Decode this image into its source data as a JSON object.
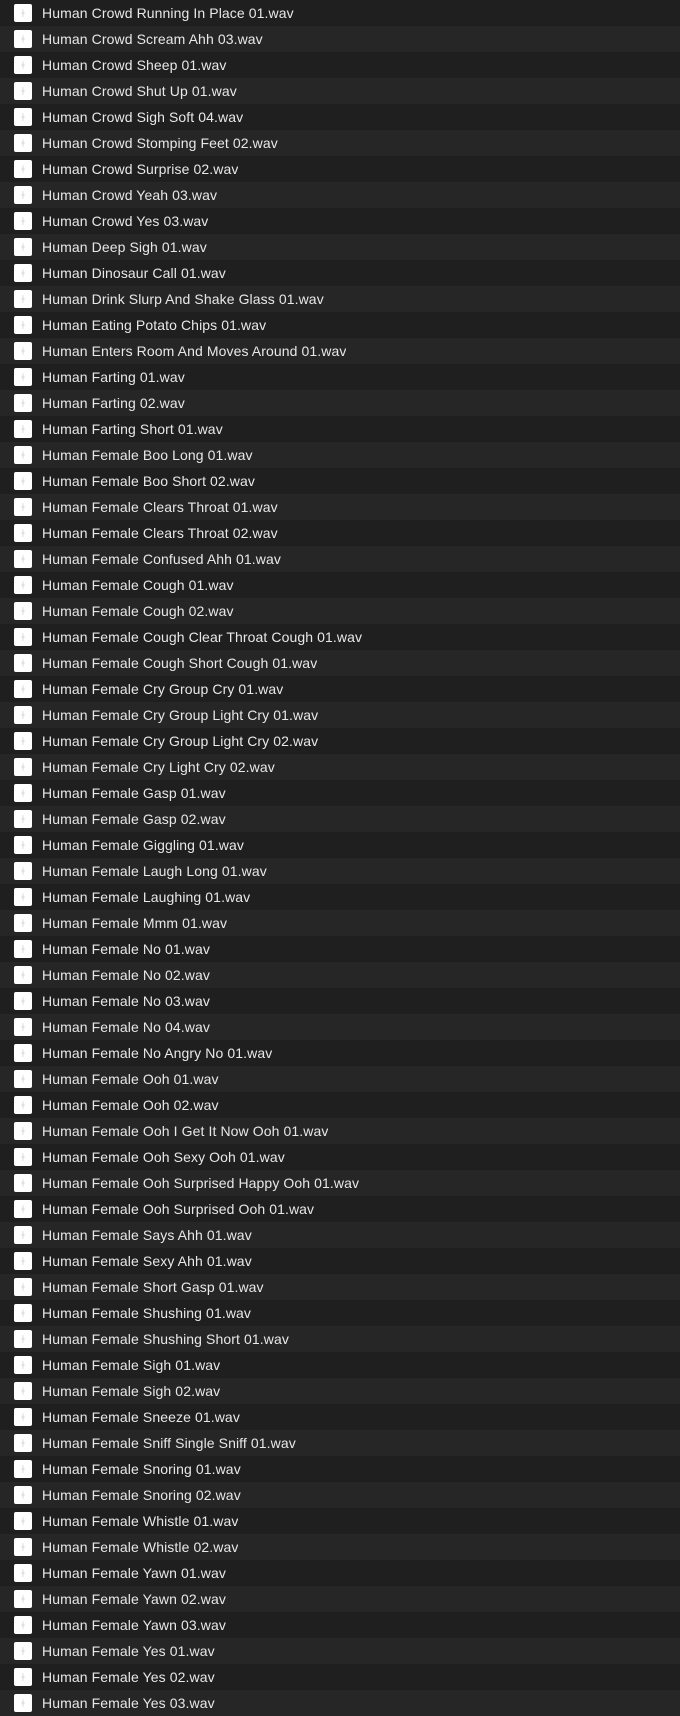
{
  "files": [
    "Human Crowd Running In Place 01.wav",
    "Human Crowd Scream Ahh 03.wav",
    "Human Crowd Sheep 01.wav",
    "Human Crowd Shut Up 01.wav",
    "Human Crowd Sigh Soft 04.wav",
    "Human Crowd Stomping Feet 02.wav",
    "Human Crowd Surprise 02.wav",
    "Human Crowd Yeah 03.wav",
    "Human Crowd Yes 03.wav",
    "Human Deep Sigh 01.wav",
    "Human Dinosaur Call 01.wav",
    "Human Drink Slurp And Shake Glass 01.wav",
    "Human Eating Potato Chips 01.wav",
    "Human Enters Room And Moves Around 01.wav",
    "Human Farting 01.wav",
    "Human Farting 02.wav",
    "Human Farting Short 01.wav",
    "Human Female Boo Long 01.wav",
    "Human Female Boo Short 02.wav",
    "Human Female Clears Throat 01.wav",
    "Human Female Clears Throat 02.wav",
    "Human Female Confused Ahh 01.wav",
    "Human Female Cough 01.wav",
    "Human Female Cough 02.wav",
    "Human Female Cough Clear Throat Cough 01.wav",
    "Human Female Cough Short Cough 01.wav",
    "Human Female Cry Group Cry 01.wav",
    "Human Female Cry Group Light Cry 01.wav",
    "Human Female Cry Group Light Cry 02.wav",
    "Human Female Cry Light Cry 02.wav",
    "Human Female Gasp 01.wav",
    "Human Female Gasp 02.wav",
    "Human Female Giggling 01.wav",
    "Human Female Laugh Long 01.wav",
    "Human Female Laughing 01.wav",
    "Human Female Mmm 01.wav",
    "Human Female No 01.wav",
    "Human Female No 02.wav",
    "Human Female No 03.wav",
    "Human Female No 04.wav",
    "Human Female No Angry No 01.wav",
    "Human Female Ooh 01.wav",
    "Human Female Ooh 02.wav",
    "Human Female Ooh I Get It Now Ooh 01.wav",
    "Human Female Ooh Sexy Ooh 01.wav",
    "Human Female Ooh Surprised Happy Ooh 01.wav",
    "Human Female Ooh Surprised Ooh 01.wav",
    "Human Female Says Ahh 01.wav",
    "Human Female Sexy Ahh 01.wav",
    "Human Female Short Gasp 01.wav",
    "Human Female Shushing 01.wav",
    "Human Female Shushing Short 01.wav",
    "Human Female Sigh 01.wav",
    "Human Female Sigh 02.wav",
    "Human Female Sneeze 01.wav",
    "Human Female Sniff Single Sniff 01.wav",
    "Human Female Snoring 01.wav",
    "Human Female Snoring 02.wav",
    "Human Female Whistle 01.wav",
    "Human Female Whistle 02.wav",
    "Human Female Yawn 01.wav",
    "Human Female Yawn 02.wav",
    "Human Female Yawn 03.wav",
    "Human Female Yes 01.wav",
    "Human Female Yes 02.wav",
    "Human Female Yes 03.wav"
  ]
}
